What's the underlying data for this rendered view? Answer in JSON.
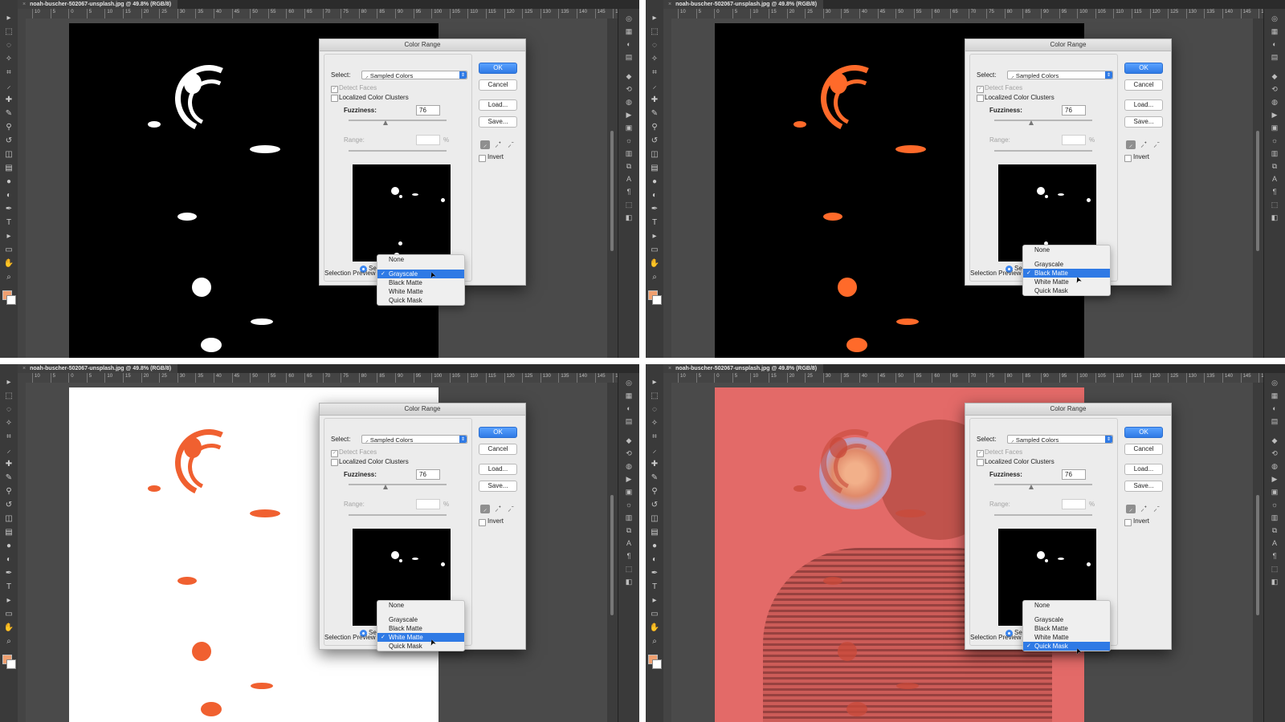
{
  "document_tab": {
    "close_glyph": "×",
    "title": "noah-buscher-502067-unsplash.jpg @ 49.8% (RGB/8)"
  },
  "ruler_ticks": [
    "10",
    "5",
    "0",
    "5",
    "10",
    "15",
    "20",
    "25",
    "30",
    "35",
    "40",
    "45",
    "50",
    "55",
    "60",
    "65",
    "70",
    "75",
    "80",
    "85",
    "90",
    "95",
    "100",
    "105",
    "110",
    "115",
    "120",
    "125",
    "130",
    "135",
    "140",
    "145",
    "150"
  ],
  "dialog": {
    "title": "Color Range",
    "select_label": "Select:",
    "select_value": "Sampled Colors",
    "detect_faces": "Detect Faces",
    "localized_clusters": "Localized Color Clusters",
    "fuzziness_label": "Fuzziness:",
    "fuzziness_value": "76",
    "range_label": "Range:",
    "range_unit": "%",
    "selection_radio": "Sel",
    "selection_preview_label": "Selection Preview",
    "ok": "OK",
    "cancel": "Cancel",
    "load": "Load...",
    "save": "Save...",
    "invert": "Invert"
  },
  "preview_menu": {
    "items": [
      "None",
      "Grayscale",
      "Black Matte",
      "White Matte",
      "Quick Mask"
    ]
  },
  "panels": [
    {
      "preview_mode": "Grayscale"
    },
    {
      "preview_mode": "Black Matte"
    },
    {
      "preview_mode": "White Matte"
    },
    {
      "preview_mode": "Quick Mask"
    }
  ],
  "colors": {
    "accent": "#2f7ae5",
    "foreground": "#f0a070",
    "quick_mask": "#e36a68",
    "ui_bg": "#535353"
  },
  "icons": [
    "move-icon",
    "marquee-icon",
    "lasso-icon",
    "magic-wand-icon",
    "crop-icon",
    "eyedropper-icon",
    "healing-icon",
    "brush-icon",
    "stamp-icon",
    "history-brush-icon",
    "eraser-icon",
    "gradient-icon",
    "blur-icon",
    "dodge-icon",
    "pen-icon",
    "type-icon",
    "path-select-icon",
    "shape-icon",
    "hand-icon",
    "zoom-icon"
  ]
}
